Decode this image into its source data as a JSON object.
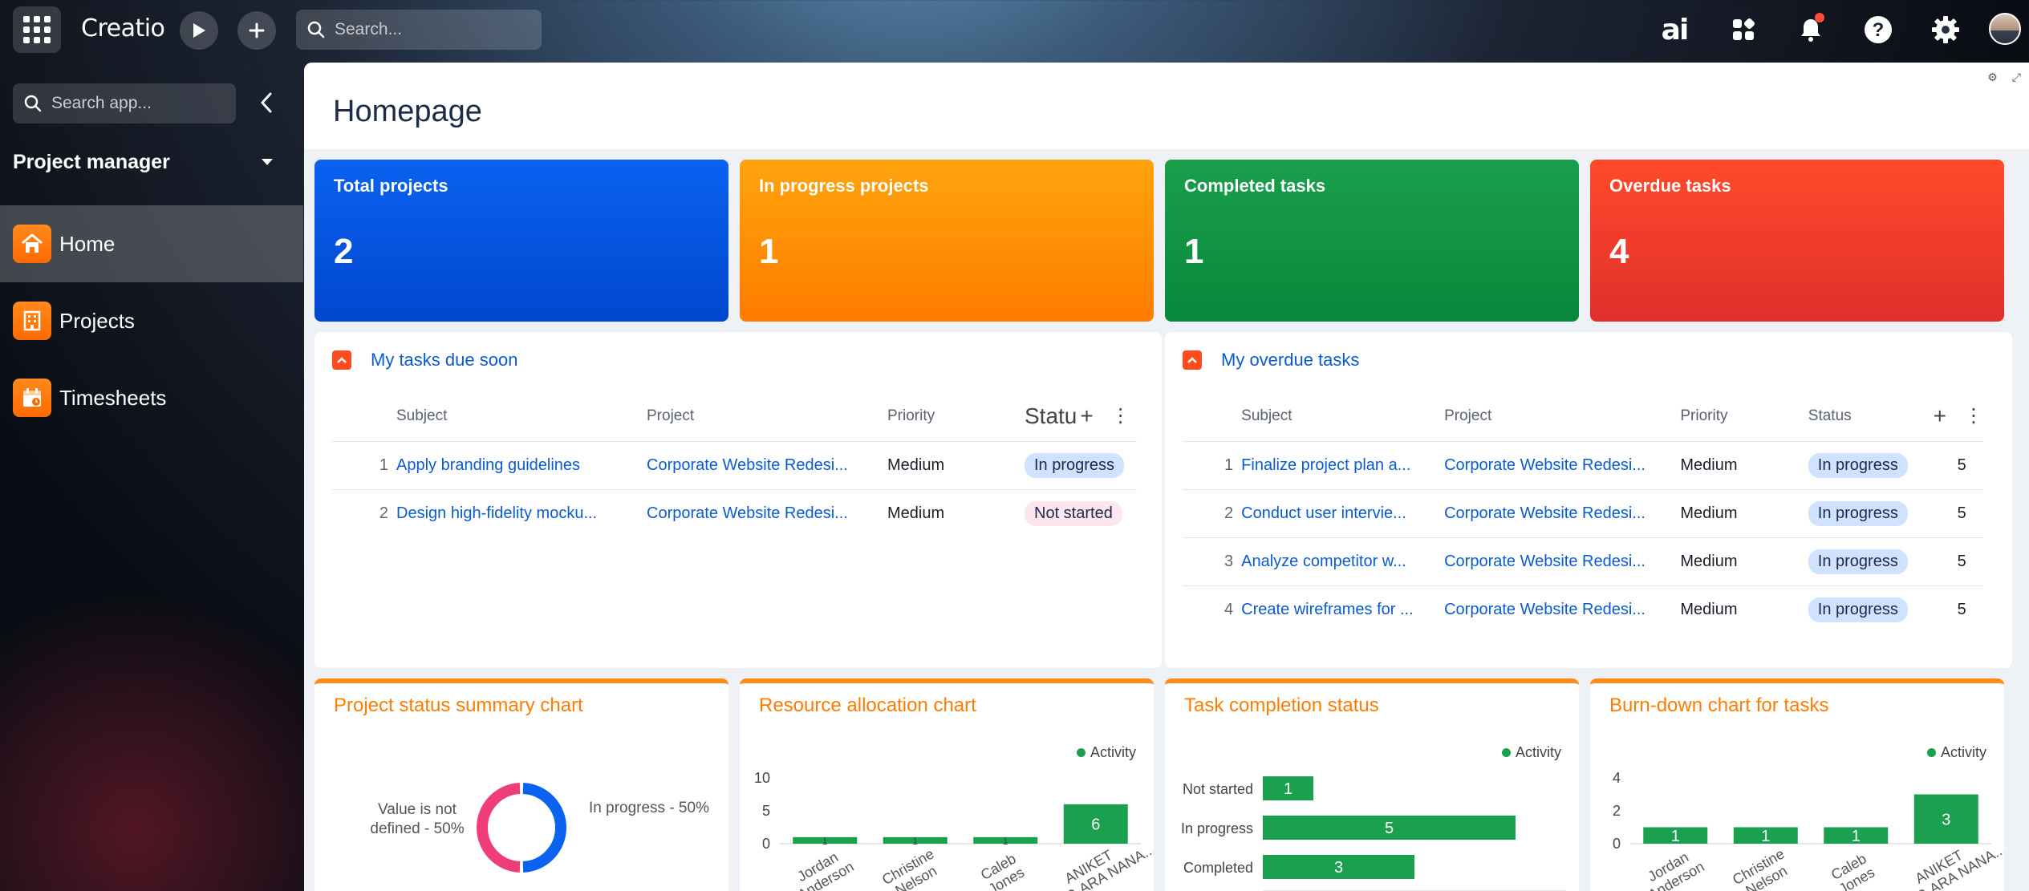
{
  "topbar": {
    "logo": "Creatio",
    "search_placeholder": "Search...",
    "ai_label": "ai"
  },
  "sidebar": {
    "search_placeholder": "Search app...",
    "workspace": "Project manager",
    "items": [
      {
        "label": "Home",
        "icon": "home-icon",
        "active": true
      },
      {
        "label": "Projects",
        "icon": "building-icon",
        "active": false
      },
      {
        "label": "Timesheets",
        "icon": "calendar-icon",
        "active": false
      }
    ]
  },
  "page": {
    "title": "Homepage"
  },
  "kpis": [
    {
      "label": "Total projects",
      "value": "2",
      "color": "#0a62f0"
    },
    {
      "label": "In progress projects",
      "value": "1",
      "color": "#ff8a00"
    },
    {
      "label": "Completed tasks",
      "value": "1",
      "color": "#0d8f41"
    },
    {
      "label": "Overdue tasks",
      "value": "4",
      "color": "#f03a2a"
    }
  ],
  "due_soon": {
    "title": "My tasks due soon",
    "columns": [
      "Subject",
      "Project",
      "Priority",
      "Statu"
    ],
    "rows": [
      {
        "n": "1",
        "subject": "Apply branding guidelines",
        "project": "Corporate Website Redesi...",
        "priority": "Medium",
        "status": "In progress"
      },
      {
        "n": "2",
        "subject": "Design high-fidelity mocku...",
        "project": "Corporate Website Redesi...",
        "priority": "Medium",
        "status": "Not started"
      }
    ]
  },
  "overdue": {
    "title": "My overdue tasks",
    "columns": [
      "Subject",
      "Project",
      "Priority",
      "Status"
    ],
    "rows": [
      {
        "n": "1",
        "subject": "Finalize project plan a...",
        "project": "Corporate Website Redesi...",
        "priority": "Medium",
        "status": "In progress",
        "extra": "5"
      },
      {
        "n": "2",
        "subject": "Conduct user intervie...",
        "project": "Corporate Website Redesi...",
        "priority": "Medium",
        "status": "In progress",
        "extra": "5"
      },
      {
        "n": "3",
        "subject": "Analyze competitor w...",
        "project": "Corporate Website Redesi...",
        "priority": "Medium",
        "status": "In progress",
        "extra": "5"
      },
      {
        "n": "4",
        "subject": "Create wireframes for ...",
        "project": "Corporate Website Redesi...",
        "priority": "Medium",
        "status": "In progress",
        "extra": "5"
      }
    ]
  },
  "charts": {
    "status_summary": {
      "title": "Project status summary chart"
    },
    "resource": {
      "title": "Resource allocation chart",
      "legend": "Activity"
    },
    "completion": {
      "title": "Task completion status",
      "legend": "Activity"
    },
    "burndown": {
      "title": "Burn-down chart for tasks",
      "legend": "Activity"
    }
  },
  "chart_data": [
    {
      "type": "pie",
      "title": "Project status summary chart",
      "slices": [
        {
          "label": "Value is not defined - 50%",
          "value": 50,
          "color": "#ef3c7b"
        },
        {
          "label": "In progress - 50%",
          "value": 50,
          "color": "#0a62f0"
        }
      ]
    },
    {
      "type": "bar",
      "title": "Resource allocation chart",
      "categories": [
        "Jordan Anderson",
        "Christine Nelson",
        "Caleb Jones",
        "ANIKET RAMC-ARA NANA..."
      ],
      "series": [
        {
          "name": "Activity",
          "values": [
            1,
            1,
            1,
            6
          ]
        }
      ],
      "yticks": [
        "0",
        "5",
        "10"
      ],
      "ylim": [
        0,
        10
      ],
      "color": "#1aa04f"
    },
    {
      "type": "bar",
      "orientation": "horizontal",
      "title": "Task completion status",
      "categories": [
        "Not started",
        "In progress",
        "Completed"
      ],
      "series": [
        {
          "name": "Activity",
          "values": [
            1,
            5,
            3
          ]
        }
      ],
      "xlim": [
        0,
        6
      ],
      "color": "#1aa04f"
    },
    {
      "type": "bar",
      "title": "Burn-down chart for tasks",
      "categories": [
        "Jordan Anderson",
        "Christine Nelson",
        "Caleb Jones",
        "ANIKET RAMC-ARA NANA..."
      ],
      "series": [
        {
          "name": "Activity",
          "values": [
            1,
            1,
            1,
            3
          ]
        }
      ],
      "yticks": [
        "0",
        "2",
        "4"
      ],
      "ylim": [
        0,
        4
      ],
      "color": "#1aa04f"
    }
  ]
}
